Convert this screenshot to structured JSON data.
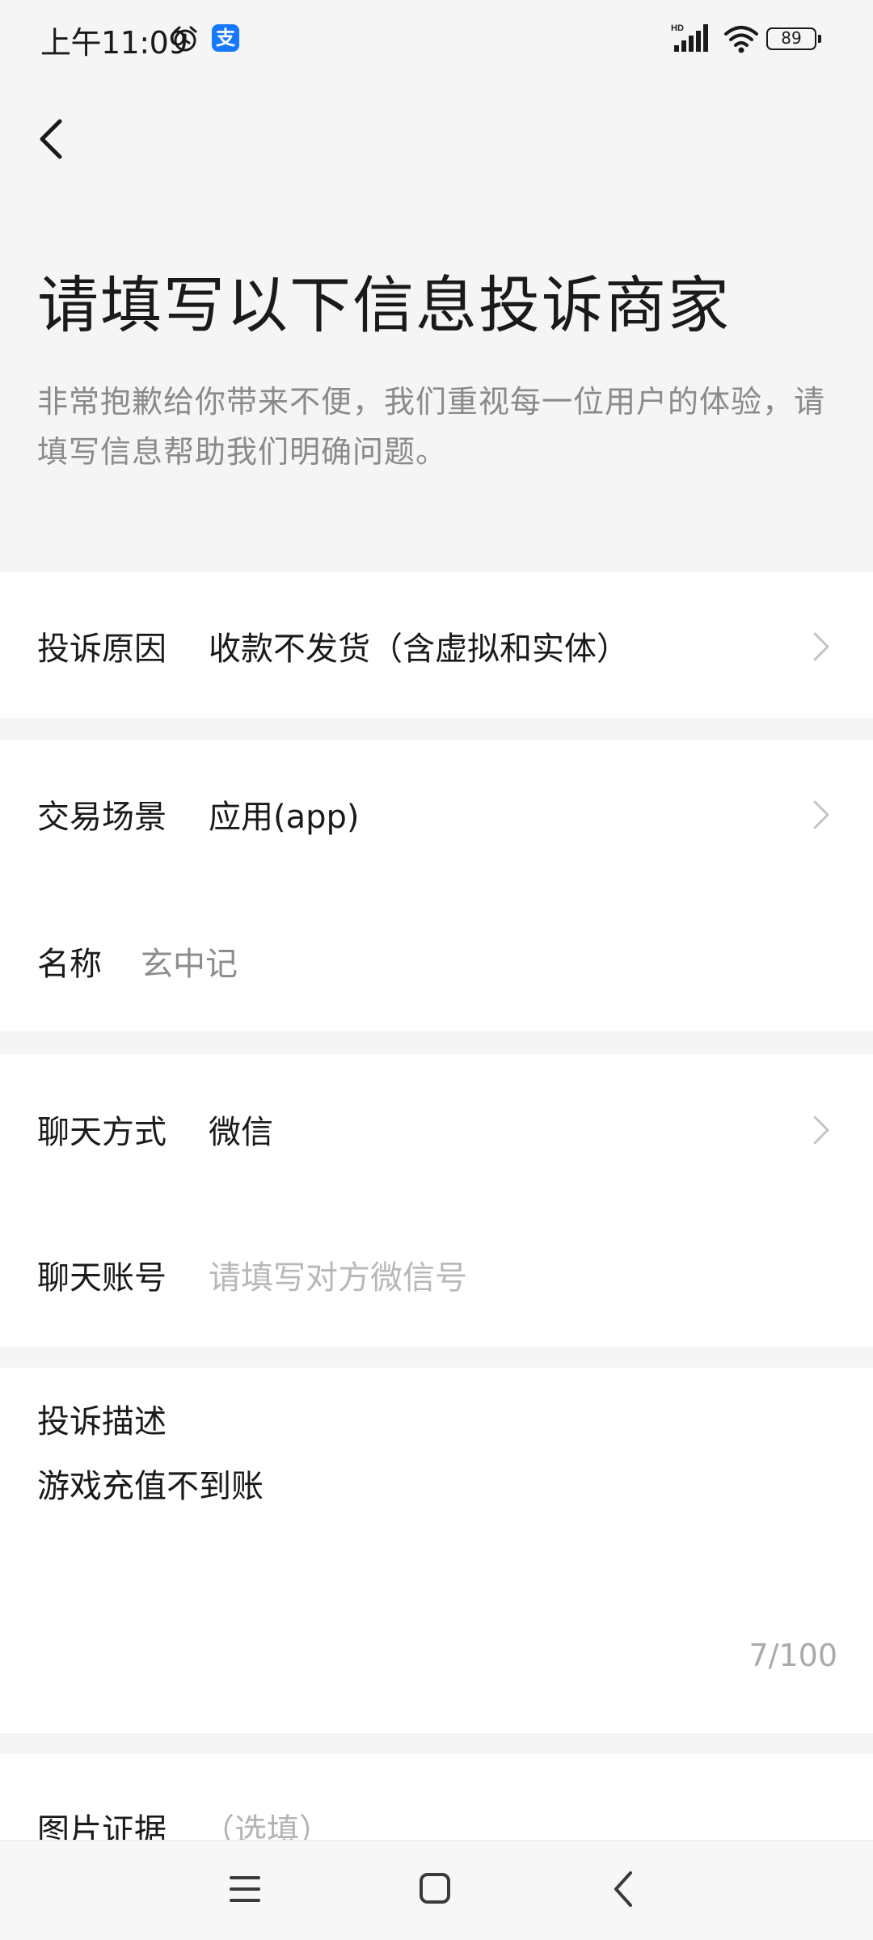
{
  "status_bar": {
    "time": "上午11:09",
    "alarm_icon": "alarm-clock-icon",
    "app_icon": "alipay-icon",
    "app_icon_glyph": "支",
    "network_label": "HD",
    "battery_level": "89"
  },
  "header": {
    "back_icon": "chevron-left-icon",
    "title": "请填写以下信息投诉商家",
    "subtitle": "非常抱歉给你带来不便，我们重视每一位用户的体验，请填写信息帮助我们明确问题。"
  },
  "form": {
    "complaint_reason": {
      "label": "投诉原因",
      "value": "收款不发货（含虚拟和实体）"
    },
    "transaction_scene": {
      "label": "交易场景",
      "value": "应用(app)"
    },
    "name": {
      "label": "名称",
      "value": "玄中记"
    },
    "chat_method": {
      "label": "聊天方式",
      "value": "微信"
    },
    "chat_account": {
      "label": "聊天账号",
      "placeholder": "请填写对方微信号"
    },
    "description": {
      "label": "投诉描述",
      "value": "游戏充值不到账",
      "counter": "7/100"
    },
    "image_evidence": {
      "label": "图片证据",
      "optional": "（选填）"
    }
  },
  "colors": {
    "background": "#f5f5f5",
    "card": "#ffffff",
    "text_primary": "#1a1a1a",
    "text_secondary": "#8a8a8a",
    "placeholder": "#b8b8b8",
    "alipay_blue": "#1677ff"
  },
  "nav_bar": {
    "menu_icon": "menu-lines-icon",
    "home_icon": "home-square-icon",
    "back_icon": "back-triangle-icon"
  }
}
